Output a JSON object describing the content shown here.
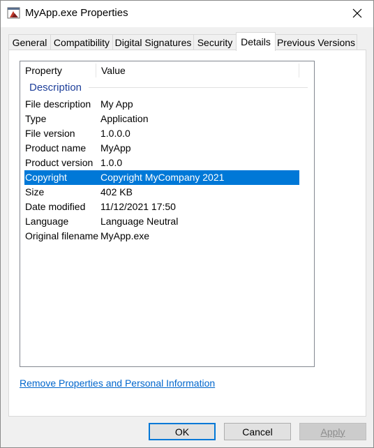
{
  "window": {
    "title": "MyApp.exe Properties"
  },
  "tabs": [
    {
      "label": "General"
    },
    {
      "label": "Compatibility"
    },
    {
      "label": "Digital Signatures"
    },
    {
      "label": "Security"
    },
    {
      "label": "Details"
    },
    {
      "label": "Previous Versions"
    }
  ],
  "active_tab": "Details",
  "list": {
    "columns": [
      "Property",
      "Value"
    ],
    "group": "Description",
    "rows": [
      {
        "property": "File description",
        "value": "My App"
      },
      {
        "property": "Type",
        "value": "Application"
      },
      {
        "property": "File version",
        "value": "1.0.0.0"
      },
      {
        "property": "Product name",
        "value": "MyApp"
      },
      {
        "property": "Product version",
        "value": "1.0.0"
      },
      {
        "property": "Copyright",
        "value": "Copyright MyCompany 2021"
      },
      {
        "property": "Size",
        "value": "402 KB"
      },
      {
        "property": "Date modified",
        "value": "11/12/2021 17:50"
      },
      {
        "property": "Language",
        "value": "Language Neutral"
      },
      {
        "property": "Original filename",
        "value": "MyApp.exe"
      }
    ],
    "selected_row": "Copyright"
  },
  "link": "Remove Properties and Personal Information",
  "buttons": {
    "ok": "OK",
    "cancel": "Cancel",
    "apply": "Apply"
  },
  "colors": {
    "selection": "#0078d7",
    "link": "#0066cc",
    "group_header": "#1e3f9a"
  }
}
